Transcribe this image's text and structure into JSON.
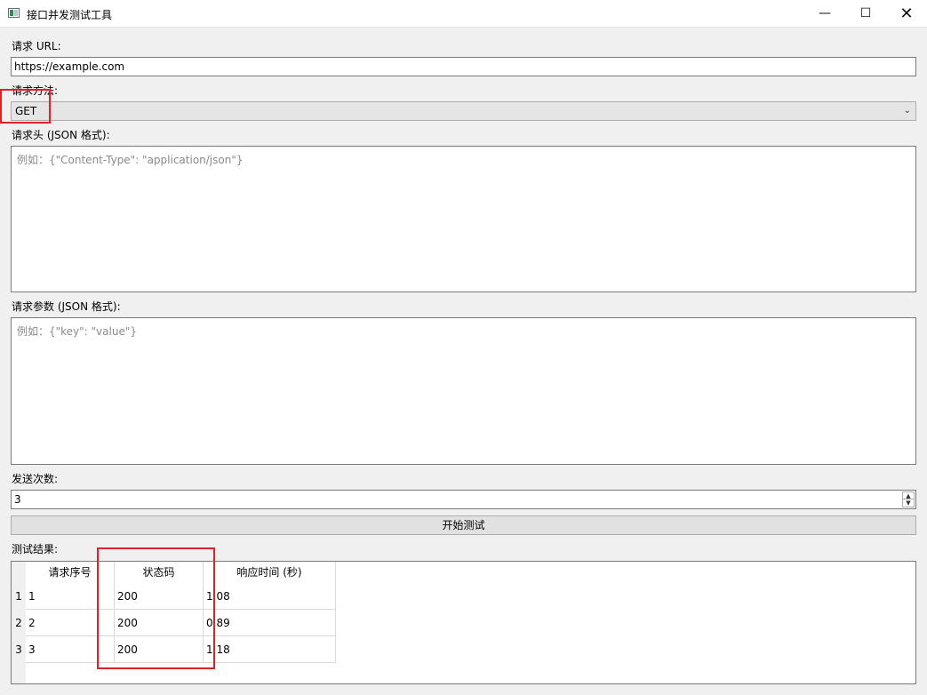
{
  "window": {
    "title": "接口并发测试工具"
  },
  "form": {
    "url_label": "请求 URL:",
    "url_value": "https://example.com",
    "method_label": "请求方法:",
    "method_value": "GET",
    "headers_label": "请求头 (JSON 格式):",
    "headers_placeholder": "例如：{\"Content-Type\": \"application/json\"}",
    "params_label": "请求参数 (JSON 格式):",
    "params_placeholder": "例如：{\"key\": \"value\"}",
    "count_label": "发送次数:",
    "count_value": "3",
    "start_button": "开始测试"
  },
  "results": {
    "label": "测试结果:",
    "columns": [
      "请求序号",
      "状态码",
      "响应时间 (秒)"
    ],
    "rows": [
      {
        "index": "1",
        "seq": "1",
        "status": "200",
        "time": "1.08"
      },
      {
        "index": "2",
        "seq": "2",
        "status": "200",
        "time": "0.89"
      },
      {
        "index": "3",
        "seq": "3",
        "status": "200",
        "time": "1.18"
      }
    ]
  },
  "colors": {
    "highlight": "#e0202a"
  }
}
